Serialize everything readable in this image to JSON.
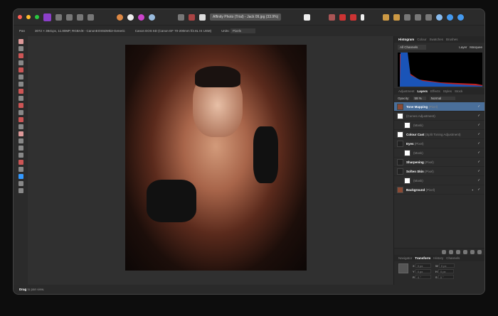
{
  "window": {
    "title": "Affinity Photo (Trial) - Jack 09.jpg (33.9%)"
  },
  "context_bar": {
    "tool": "Pan",
    "doc_info": "3072 × 3841px, 11.80MP, RGBA/8 - CanonEOS5DMk3-Generic",
    "camera": "Canon EOS 6D (Canon EF 70-200mm f/2.8L IS USM)",
    "units_label": "Units:",
    "units_value": "Pixels"
  },
  "histogram_panel": {
    "tabs": [
      "Histogram",
      "Colour",
      "Swatches",
      "Brushes"
    ],
    "channel": "All Channels",
    "options": [
      "Layer",
      "Marquee"
    ]
  },
  "layers_panel": {
    "tabs": [
      "Adjustment",
      "Layers",
      "Effects",
      "Styles",
      "Stock"
    ],
    "opacity_label": "Opacity:",
    "opacity_value": "59 %",
    "blend_mode": "Normal",
    "layers": [
      {
        "name": "Tone Mapping",
        "type": "(Pixel)"
      },
      {
        "name": "",
        "type": "(Curves Adjustment)"
      },
      {
        "name": "",
        "type": "(Mask)"
      },
      {
        "name": "Colour Cast",
        "type": "(Split Toning Adjustment)"
      },
      {
        "name": "Eyes",
        "type": "(Pixel)"
      },
      {
        "name": "",
        "type": "(Mask)"
      },
      {
        "name": "Sharpening",
        "type": "(Pixel)"
      },
      {
        "name": "Soften Skin",
        "type": "(Pixel)"
      },
      {
        "name": "",
        "type": "(Mask)"
      },
      {
        "name": "Background",
        "type": "(Pixel)"
      }
    ]
  },
  "transform_panel": {
    "tabs": [
      "Navigator",
      "Transform",
      "History",
      "Channels"
    ],
    "fields": [
      {
        "l": "X",
        "v": "0 px"
      },
      {
        "l": "W",
        "v": "0 px"
      },
      {
        "l": "Y",
        "v": "0 px"
      },
      {
        "l": "H",
        "v": "0 px"
      },
      {
        "l": "R",
        "v": "0 °"
      },
      {
        "l": "S",
        "v": "0 °"
      }
    ]
  },
  "status": {
    "bold": "Drag",
    "rest": " to pan view."
  }
}
